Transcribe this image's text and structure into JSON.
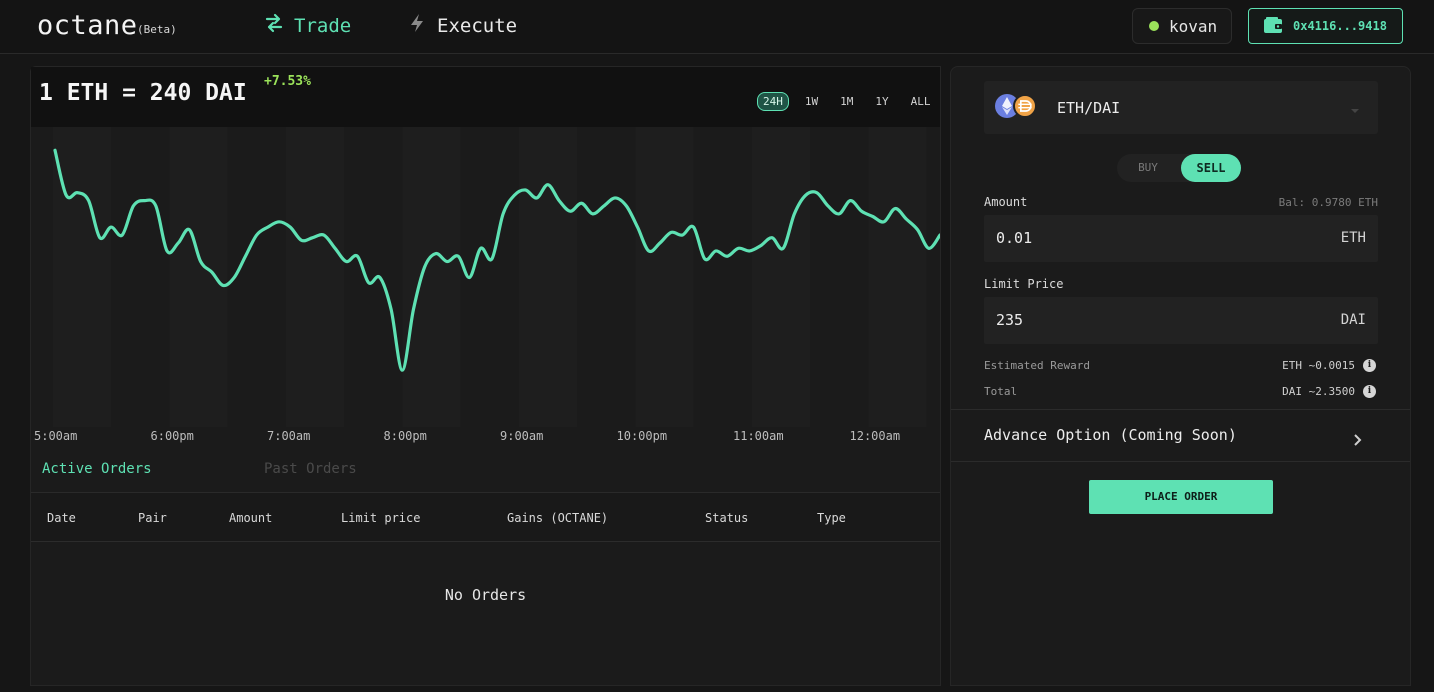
{
  "header": {
    "logo": "octane",
    "beta": "(Beta)",
    "nav": [
      {
        "label": "Trade",
        "icon": "swap-arrows-icon",
        "active": true
      },
      {
        "label": "Execute",
        "icon": "lightning-icon",
        "active": false
      }
    ],
    "network": {
      "label": "kovan",
      "status_color": "#9be35a"
    },
    "wallet": {
      "address": "0x4116...9418",
      "icon": "wallet-icon"
    }
  },
  "chart_panel": {
    "title": "1 ETH = 240 DAI",
    "change": "+7.53%",
    "ranges": [
      "24H",
      "1W",
      "1M",
      "1Y",
      "ALL"
    ],
    "active_range": "24H"
  },
  "chart_data": {
    "type": "line",
    "title": "1 ETH = 240 DAI",
    "xlabel": "",
    "ylabel": "",
    "x_ticks": [
      "5:00am",
      "6:00pm",
      "7:00am",
      "8:00pm",
      "9:00am",
      "10:00pm",
      "11:00am",
      "12:00am"
    ],
    "ylim": [
      0,
      100
    ],
    "grid": false,
    "series": [
      {
        "color": "#5ee1b3",
        "values": [
          95,
          78,
          79,
          76,
          62,
          66,
          63,
          74,
          76,
          74,
          57,
          60,
          65,
          53,
          49,
          44,
          47,
          55,
          63,
          66,
          68,
          66,
          61,
          62,
          63,
          58,
          53,
          55,
          45,
          47,
          35,
          12,
          35,
          51,
          56,
          53,
          55,
          47,
          58,
          54,
          71,
          78,
          80,
          77,
          82,
          76,
          72,
          75,
          71,
          74,
          77,
          74,
          66,
          57,
          60,
          64,
          63,
          66,
          54,
          57,
          55,
          58,
          57,
          59,
          62,
          58,
          71,
          78,
          79,
          74,
          71,
          76,
          72,
          70,
          68,
          73,
          69,
          65,
          58,
          63
        ]
      }
    ]
  },
  "orders": {
    "tabs": [
      {
        "label": "Active Orders",
        "active": true
      },
      {
        "label": "Past Orders",
        "active": false
      }
    ],
    "columns": [
      "Date",
      "Pair",
      "Amount",
      "Limit price",
      "Gains (OCTANE)",
      "Status",
      "Type"
    ],
    "rows": [],
    "empty_text": "No Orders"
  },
  "order_form": {
    "pair": "ETH/DAI",
    "pair_icons": [
      "eth-coin-icon",
      "dai-coin-icon"
    ],
    "sides": [
      "BUY",
      "SELL"
    ],
    "active_side": "SELL",
    "amount": {
      "label": "Amount",
      "balance": "Bal: 0.9780 ETH",
      "value": "0.01",
      "unit": "ETH"
    },
    "limit_price": {
      "label": "Limit Price",
      "value": "235",
      "unit": "DAI"
    },
    "estimated_reward": {
      "label": "Estimated Reward",
      "value": "ETH ~0.0015"
    },
    "total": {
      "label": "Total",
      "value": "DAI ~2.3500"
    },
    "advance_option": "Advance Option (Coming Soon)",
    "submit_label": "PLACE ORDER"
  },
  "colors": {
    "accent": "#5ee1b3",
    "positive": "#9be35a",
    "background": "#161616"
  }
}
